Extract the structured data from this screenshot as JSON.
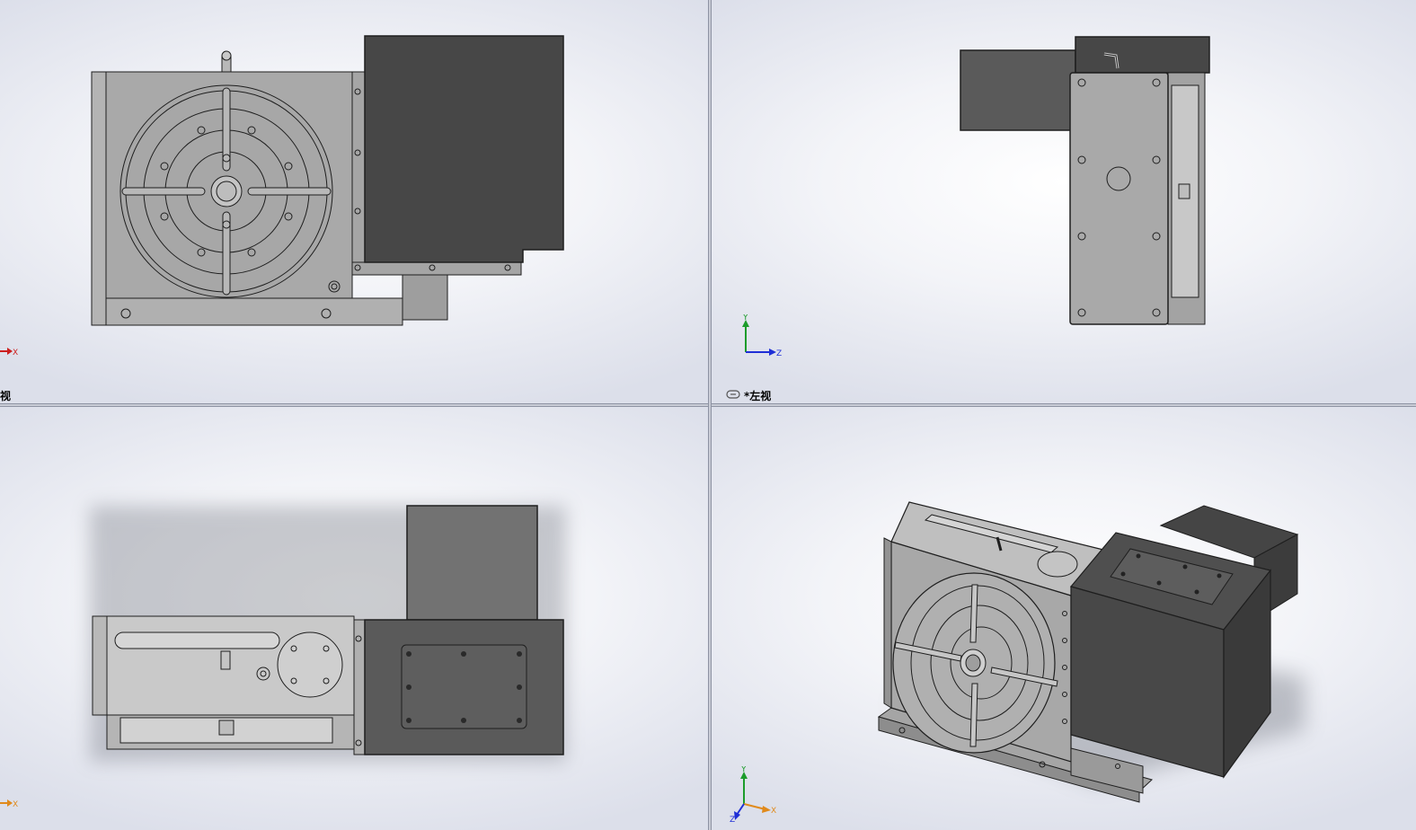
{
  "viewports": {
    "top_left": {
      "view_label": "视",
      "triad_axes": [
        "X"
      ]
    },
    "top_right": {
      "view_label": "*左视",
      "triad_axes": [
        "Y",
        "Z"
      ]
    },
    "bottom_left": {
      "triad_axes": [
        "X"
      ]
    },
    "bottom_right": {
      "triad_axes": [
        "Y",
        "X",
        "Z"
      ]
    }
  },
  "colors": {
    "body_gray": "#a9a9a9",
    "dark_housing": "#474747",
    "mid_housing": "#727272",
    "edge_line": "#1e1e1e",
    "x_axis": "#cc1f1f",
    "y_axis": "#1c9c2b",
    "z_axis": "#1f2fd6",
    "iso_x_axis": "#e08a1c"
  },
  "icons": [
    "axis-triad-icon",
    "view-link-icon"
  ]
}
